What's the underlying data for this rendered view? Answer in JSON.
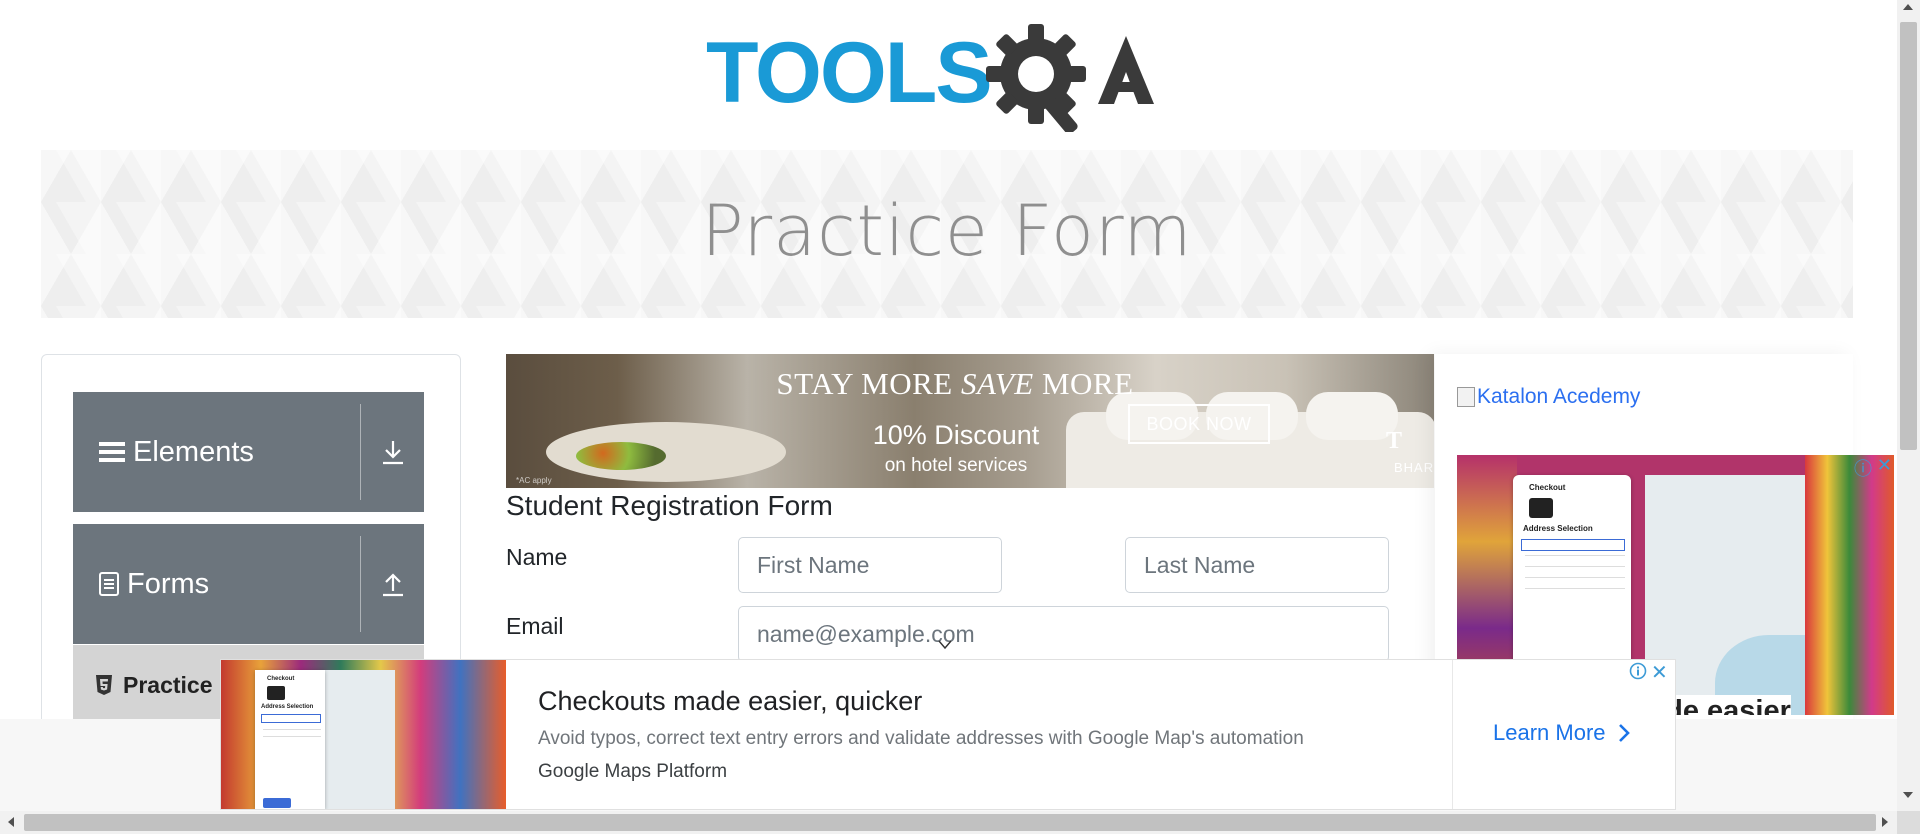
{
  "header": {
    "logo_text": "TOOLSQA",
    "page_heading": "Practice Form"
  },
  "sidebar": {
    "groups": [
      {
        "label": "Elements",
        "icon": "hamburger-icon",
        "toggle_icon": "download-arrow-icon"
      },
      {
        "label": "Forms",
        "icon": "document-icon",
        "toggle_icon": "upload-arrow-icon"
      }
    ],
    "active_item": {
      "label": "Practice",
      "icon": "html5-icon"
    }
  },
  "hotel_ad": {
    "headline_pre": "STAY MORE ",
    "headline_em": "SAVE",
    "headline_post": " MORE",
    "discount": "10% Discount",
    "subline": "on hotel services",
    "cta": "BOOK NOW",
    "brand_partial": "T",
    "brand_sub_partial": "BHART",
    "fine_print": "*AC apply"
  },
  "form": {
    "title": "Student Registration Form",
    "name_label": "Name",
    "first_name_placeholder": "First Name",
    "last_name_placeholder": "Last Name",
    "email_label": "Email",
    "email_placeholder": "name@example.com"
  },
  "right_column": {
    "katalon_link": "Katalon Acedemy",
    "side_ad_peek_text": "ade easier",
    "side_ad_card_title": "Checkout",
    "side_ad_card_section": "Address Selection"
  },
  "bottom_ad": {
    "title": "Checkouts made easier, quicker",
    "description": "Avoid typos, correct text entry errors and validate addresses with Google Map's automation",
    "brand": "Google Maps Platform",
    "cta": "Learn More",
    "card_title": "Checkout",
    "card_section": "Address Selection"
  },
  "colors": {
    "logo_blue": "#1a9ad6",
    "logo_gray": "#3a3a3a",
    "sidebar_header": "#6c757d",
    "sidebar_active": "#d4d4d4",
    "link_blue": "#2b6ff0",
    "ad_cta_blue": "#1a73e8"
  }
}
